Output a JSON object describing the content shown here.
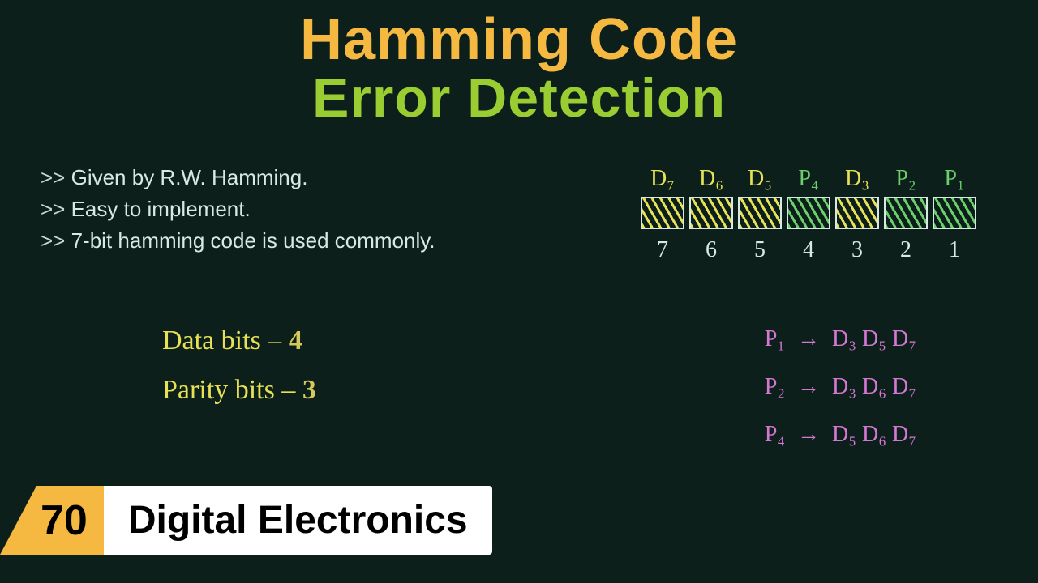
{
  "title": {
    "line1": "Hamming Code",
    "line2": "Error Detection"
  },
  "bullets": [
    "Given by R.W. Hamming.",
    "Easy to implement.",
    "7-bit hamming code is used commonly."
  ],
  "handwriting": {
    "data_label": "Data bits –",
    "data_count": "4",
    "parity_label": "Parity bits –",
    "parity_count": "3"
  },
  "diagram": {
    "top_labels": [
      {
        "text": "D₇",
        "type": "data"
      },
      {
        "text": "D₆",
        "type": "data"
      },
      {
        "text": "D₅",
        "type": "data"
      },
      {
        "text": "P₄",
        "type": "parity"
      },
      {
        "text": "D₃",
        "type": "data"
      },
      {
        "text": "P₂",
        "type": "parity"
      },
      {
        "text": "P₁",
        "type": "parity"
      }
    ],
    "bottom_labels": [
      "7",
      "6",
      "5",
      "4",
      "3",
      "2",
      "1"
    ]
  },
  "relations": [
    {
      "p": "P₁",
      "checks": "D₃ D₅ D₇"
    },
    {
      "p": "P₂",
      "checks": "D₃ D₆ D₇"
    },
    {
      "p": "P₄",
      "checks": "D₅ D₆ D₇"
    }
  ],
  "footer": {
    "number": "70",
    "label": "Digital Electronics"
  }
}
